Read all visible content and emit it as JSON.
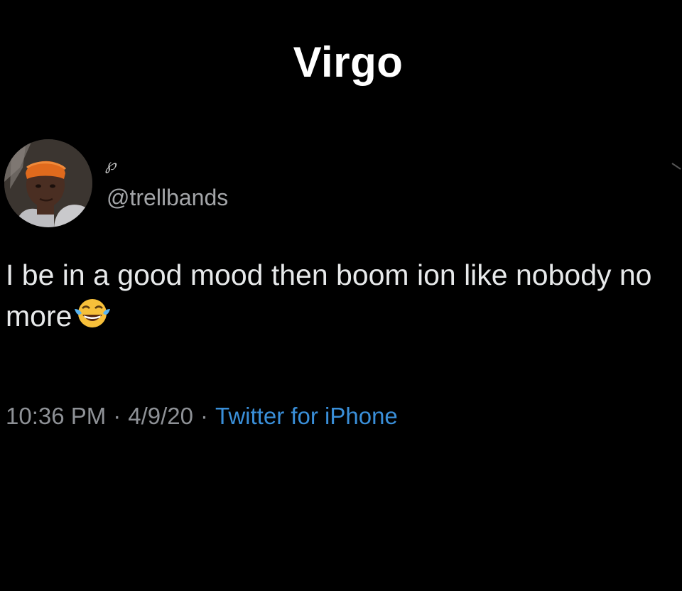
{
  "caption": "Virgo",
  "tweet": {
    "display_name": "℘",
    "handle": "@trellbands",
    "text": "I be in a good mood then boom ion like nobody no more",
    "emoji": "face-with-tears-of-joy",
    "time": "10:36 PM",
    "separator": "·",
    "date": "4/9/20",
    "source": "Twitter for iPhone"
  },
  "colors": {
    "background": "#000000",
    "caption": "#ffffff",
    "tweet_text": "#e7e9ea",
    "handle": "#a3a5a8",
    "meta": "#8e9196",
    "source_link": "#3a8fd9"
  }
}
